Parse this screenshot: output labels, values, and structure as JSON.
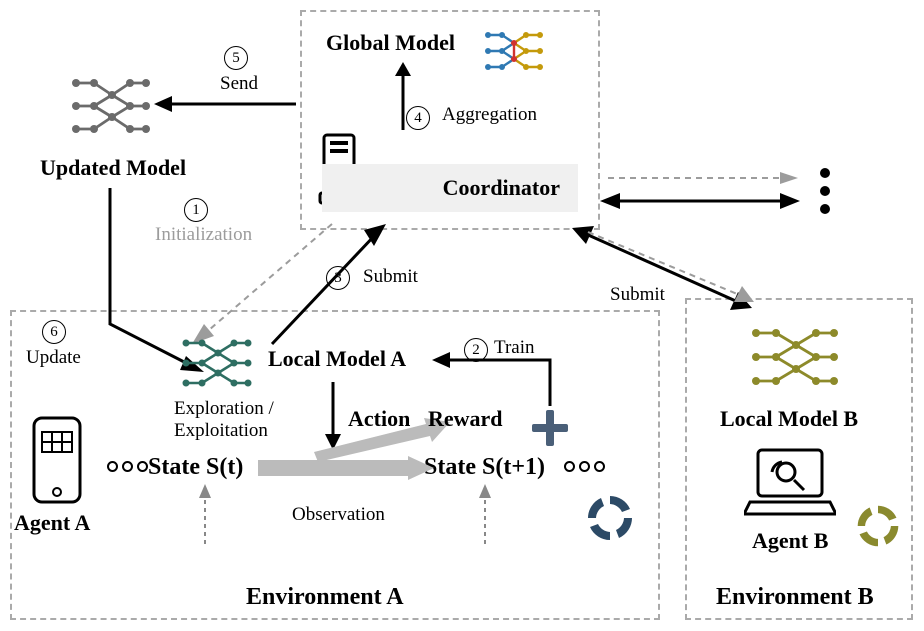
{
  "nodes": {
    "global_model": "Global Model",
    "coordinator": "Coordinator",
    "updated_model": "Updated Model",
    "local_model_a": "Local Model A",
    "local_model_b": "Local Model B",
    "agent_a": "Agent A",
    "agent_b": "Agent B",
    "state_t": "State S(t)",
    "state_t1": "State S(t+1)",
    "action": "Action",
    "reward": "Reward",
    "env_a": "Environment A",
    "env_b": "Environment B"
  },
  "annotations": {
    "exploration": "Exploration /",
    "exploitation": "Exploitation",
    "observation": "Observation"
  },
  "steps": {
    "s1": {
      "num": "1",
      "label": "Initialization"
    },
    "s2": {
      "num": "2",
      "label": "Train"
    },
    "s3": {
      "num": "3",
      "label": "Submit"
    },
    "s3b": {
      "label": "Submit"
    },
    "s4": {
      "num": "4",
      "label": "Aggregation"
    },
    "s5": {
      "num": "5",
      "label": "Send"
    },
    "s6": {
      "num": "6",
      "label": "Update"
    }
  },
  "colors": {
    "updated_model": "#6b6b6b",
    "global_model_left": "#2f79b3",
    "global_model_mid": "#d0332f",
    "global_model_right": "#c49a0b",
    "local_model_a": "#2e6e62",
    "local_model_b": "#8d8a2a",
    "reward_plus": "#4a5f78",
    "cycle_a": "#2c4a66",
    "cycle_b": "#8a8a2e"
  }
}
